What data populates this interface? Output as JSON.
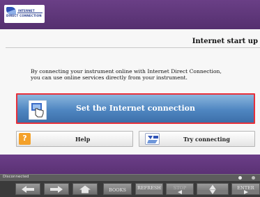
{
  "header": {
    "logo_line1": "INTERNET",
    "logo_line2": "DIRECT CONNECTION"
  },
  "page": {
    "title": "Internet start up",
    "description": "By connecting your instrument online with Internet Direct Connection, you can use online services directly from your instrument."
  },
  "buttons": {
    "primary_label": "Set the Internet connection",
    "help_label": "Help",
    "try_label": "Try connecting"
  },
  "status": {
    "text": "Disconnected"
  },
  "nav": {
    "books_label": "BOOKS",
    "refresh_label": "REFRESH",
    "stop_label": "STOP",
    "enter_label": "ENTER"
  },
  "colors": {
    "header": "#5b3274",
    "primary_button": "#4f86c1",
    "highlight_border": "#e8303a"
  },
  "icons": {
    "primary": "hand-pointer-icon",
    "help": "help-icon",
    "try": "connection-icon",
    "back": "arrow-left-icon",
    "forward": "arrow-right-icon",
    "home": "home-icon",
    "up": "triangle-up-icon",
    "down": "triangle-down-icon",
    "left": "triangle-left-icon",
    "right": "triangle-right-icon"
  }
}
